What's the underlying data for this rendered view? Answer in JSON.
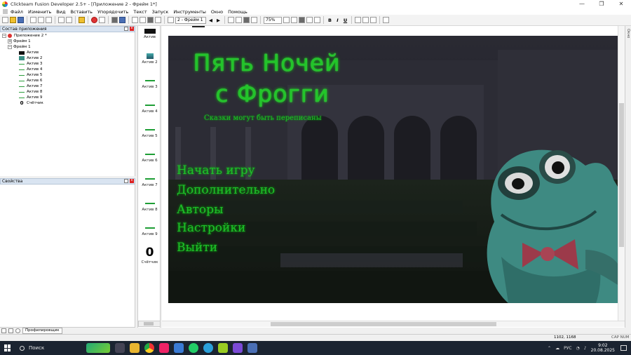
{
  "window": {
    "title": "Clickteam Fusion Developer 2.5+ - [Приложение 2 - Фрейм 1*]",
    "minimize": "—",
    "maximize": "❐",
    "close": "✕"
  },
  "menu": [
    "Файл",
    "Изменить",
    "Вид",
    "Вставить",
    "Упорядочить",
    "Текст",
    "Запуск",
    "Инструменты",
    "Окно",
    "Помощь"
  ],
  "toolbar": {
    "frame_select": "2 - Фрейм 1",
    "zoom": "75%",
    "bold": "B",
    "italic": "I",
    "underline": "U"
  },
  "workspace": {
    "header": "Состав приложения",
    "items": [
      {
        "label": "Приложение 2 *",
        "depth": 0,
        "icon": "app",
        "exp": "−"
      },
      {
        "label": "Фрейм 1",
        "depth": 1,
        "icon": "frame",
        "exp": "+"
      },
      {
        "label": "Фрейм 1",
        "depth": 1,
        "icon": "frame",
        "exp": "−"
      },
      {
        "label": "Актив",
        "depth": 2,
        "icon": "blk",
        "exp": ""
      },
      {
        "label": "Актив 2",
        "depth": 2,
        "icon": "frog",
        "exp": ""
      },
      {
        "label": "Актив 3",
        "depth": 2,
        "icon": "line",
        "exp": ""
      },
      {
        "label": "Актив 4",
        "depth": 2,
        "icon": "line",
        "exp": ""
      },
      {
        "label": "Актив 5",
        "depth": 2,
        "icon": "line",
        "exp": ""
      },
      {
        "label": "Актив 6",
        "depth": 2,
        "icon": "line",
        "exp": ""
      },
      {
        "label": "Актив 7",
        "depth": 2,
        "icon": "line",
        "exp": ""
      },
      {
        "label": "Актив 8",
        "depth": 2,
        "icon": "line",
        "exp": ""
      },
      {
        "label": "Актив 9",
        "depth": 2,
        "icon": "line",
        "exp": ""
      },
      {
        "label": "Счётчик",
        "depth": 2,
        "icon": "cnt",
        "exp": ""
      }
    ],
    "counter_glyph": "0"
  },
  "properties": {
    "header": "Свойства"
  },
  "left_status": {
    "tab": "Профилировщик"
  },
  "shelf": [
    {
      "label": "Актив",
      "swatch": "blk"
    },
    {
      "label": "Актив 2",
      "swatch": "frog"
    },
    {
      "label": "Актив 3",
      "swatch": "line"
    },
    {
      "label": "Актив 4",
      "swatch": "line"
    },
    {
      "label": "Актив 5",
      "swatch": "line"
    },
    {
      "label": "Актив 6",
      "swatch": "line"
    },
    {
      "label": "Актив 7",
      "swatch": "line"
    },
    {
      "label": "Актив 8",
      "swatch": "line"
    },
    {
      "label": "Актив 9",
      "swatch": "line"
    },
    {
      "label": "Счётчик",
      "swatch": "num",
      "glyph": "0"
    }
  ],
  "game": {
    "title_line1": "Пять Ночей",
    "title_line2": "с Фрогги",
    "subtitle": "Сказки могут быть переписаны",
    "menu": [
      "Начать игру",
      "Дополнительно",
      "Авторы",
      "Настройки",
      "Выйти"
    ],
    "accent_color": "#22c42a"
  },
  "side_strip": {
    "label": "Окно"
  },
  "status": {
    "coords": "1102, 1168",
    "caps": "CAP NUM"
  },
  "taskbar": {
    "search": "Поиск",
    "lang": "РУС",
    "time": "9:02",
    "date": "20.08.2025"
  }
}
